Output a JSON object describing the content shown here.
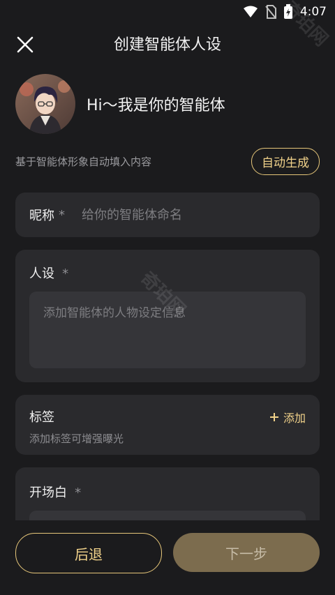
{
  "status": {
    "time": "4:07"
  },
  "header": {
    "title": "创建智能体人设"
  },
  "agent": {
    "greeting": "Hi～我是你的智能体"
  },
  "auto": {
    "hint": "基于智能体形象自动填入内容",
    "button": "自动生成"
  },
  "name_field": {
    "label": "昵称",
    "required_mark": "*",
    "placeholder": "给你的智能体命名"
  },
  "persona_field": {
    "label": "人设",
    "required_mark": "*",
    "placeholder": "添加智能体的人物设定信息"
  },
  "tags_field": {
    "label": "标签",
    "hint": "添加标签可增强曝光",
    "add_label": "添加"
  },
  "opening_field": {
    "label": "开场白",
    "required_mark": "*"
  },
  "footer": {
    "back": "后退",
    "next": "下一步"
  },
  "watermark": "奇珀网",
  "colors": {
    "background": "#1b1b1d",
    "card": "#2a2a2d",
    "accent": "#e7c77a",
    "next_button": "#7c6c4e"
  }
}
